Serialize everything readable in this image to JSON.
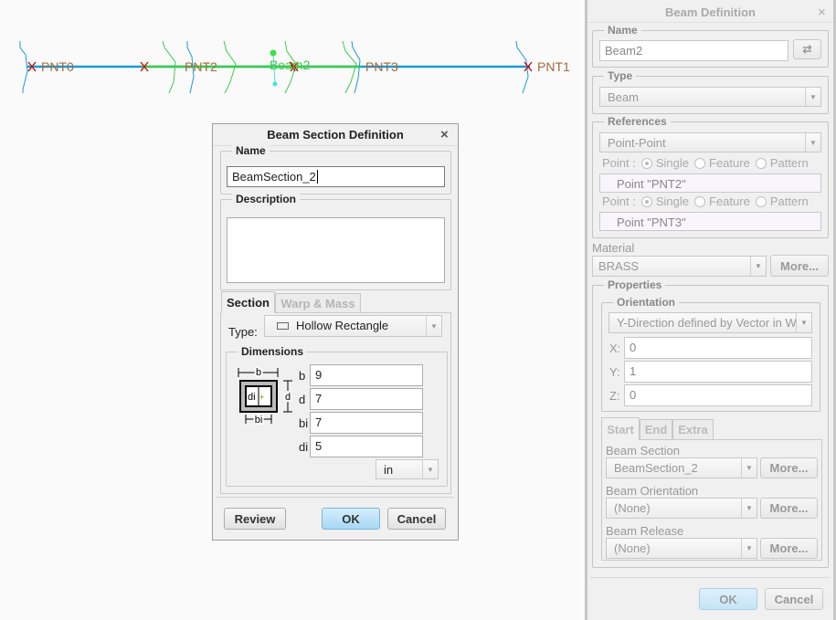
{
  "canvas": {
    "points": [
      "PNT0",
      "PNT2",
      "PNT3",
      "PNT1"
    ],
    "beam_label": "Beam2",
    "colors": {
      "line": "#1a9ad6",
      "beam": "#3ccc4a",
      "label": "#a06a3a"
    }
  },
  "section_dialog": {
    "title": "Beam Section Definition",
    "close": "×",
    "name_label": "Name",
    "name_value": "BeamSection_2",
    "description_label": "Description",
    "description_value": "",
    "tabs": [
      "Section",
      "Warp & Mass"
    ],
    "type_label": "Type:",
    "type_value": "Hollow Rectangle",
    "dimensions_label": "Dimensions",
    "diagram": {
      "b": "b",
      "d": "d",
      "bi": "bi",
      "di": "di"
    },
    "dims": [
      {
        "label": "b",
        "value": "9"
      },
      {
        "label": "d",
        "value": "7"
      },
      {
        "label": "bi",
        "value": "7"
      },
      {
        "label": "di",
        "value": "5"
      }
    ],
    "unit": "in",
    "review": "Review",
    "ok": "OK",
    "cancel": "Cancel"
  },
  "beam_definition": {
    "title": "Beam Definition",
    "close": "×",
    "name_label": "Name",
    "name_value": "Beam2",
    "type_label": "Type",
    "type_value": "Beam",
    "references_label": "References",
    "references_value": "Point-Point",
    "point_label": "Point :",
    "options": [
      "Single",
      "Feature",
      "Pattern"
    ],
    "point1": "Point \"PNT2\"",
    "point2": "Point \"PNT3\"",
    "material_label": "Material",
    "material_value": "BRASS",
    "more": "More...",
    "properties_label": "Properties",
    "orientation_label": "Orientation",
    "orientation_value": "Y-Direction defined by Vector in W",
    "x_label": "X:",
    "x_value": "0",
    "y_label": "Y:",
    "y_value": "1",
    "z_label": "Z:",
    "z_value": "0",
    "tabs": [
      "Start",
      "End",
      "Extra"
    ],
    "beam_section_label": "Beam Section",
    "beam_section_value": "BeamSection_2",
    "beam_orientation_label": "Beam Orientation",
    "beam_orientation_value": "(None)",
    "beam_release_label": "Beam Release",
    "beam_release_value": "(None)",
    "ok": "OK",
    "cancel": "Cancel"
  }
}
